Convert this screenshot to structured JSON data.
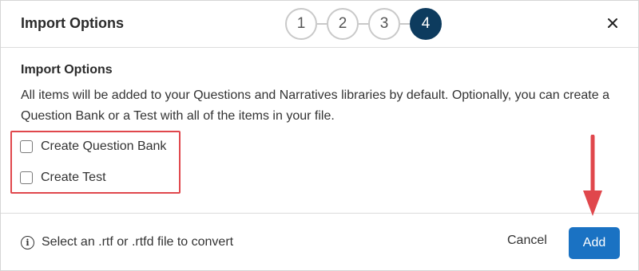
{
  "header": {
    "title": "Import Options",
    "close_icon": "close-icon",
    "steps": [
      "1",
      "2",
      "3",
      "4"
    ],
    "active_step": "4"
  },
  "body": {
    "subtitle": "Import Options",
    "description": "All items will be added to your Questions and Narratives libraries by default. Optionally, you can create a Question Bank or a Test with all of the items in your file.",
    "options": [
      {
        "label": "Create Question Bank",
        "checked": false
      },
      {
        "label": "Create Test",
        "checked": false
      }
    ]
  },
  "footer": {
    "info_icon": "info-icon",
    "note": "Select an .rtf or .rtfd file to convert",
    "cancel_label": "Cancel",
    "add_label": "Add"
  },
  "colors": {
    "active_step": "#0d3b5e",
    "primary_button": "#1a72c3",
    "annotation": "#e0474c"
  }
}
